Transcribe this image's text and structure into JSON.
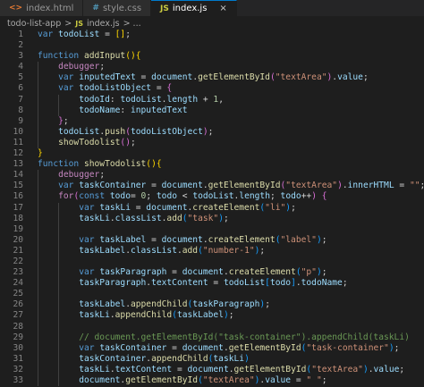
{
  "tabs": [
    {
      "icon": "html-file-icon",
      "icon_glyph": "<>",
      "icon_color": "#e37933",
      "label": "index.html",
      "active": false
    },
    {
      "icon": "css-file-icon",
      "icon_glyph": "#",
      "icon_color": "#519aba",
      "label": "style.css",
      "active": false
    },
    {
      "icon": "js-file-icon",
      "icon_glyph": "JS",
      "icon_color": "#cbcb41",
      "label": "index.js",
      "active": true
    }
  ],
  "close_glyph": "×",
  "breadcrumb": {
    "folder": "todo-list-app",
    "separator": ">",
    "badge": "JS",
    "file": "index.js",
    "tail": "> ..."
  },
  "lines": [
    {
      "n": "1",
      "tokens": [
        [
          "kw",
          "var "
        ],
        [
          "var",
          "todoList"
        ],
        [
          "plain",
          " = "
        ],
        [
          "br1",
          "[]"
        ],
        [
          "plain",
          ";"
        ]
      ]
    },
    {
      "n": "2",
      "tokens": []
    },
    {
      "n": "3",
      "tokens": [
        [
          "kw",
          "function "
        ],
        [
          "fn",
          "addInput"
        ],
        [
          "br1",
          "()"
        ],
        [
          "br1",
          "{"
        ]
      ]
    },
    {
      "n": "4",
      "indent": 1,
      "tokens": [
        [
          "ctl",
          "    debugger"
        ],
        [
          "plain",
          ";"
        ]
      ]
    },
    {
      "n": "5",
      "indent": 1,
      "tokens": [
        [
          "kw",
          "    var "
        ],
        [
          "var",
          "inputedText"
        ],
        [
          "plain",
          " = "
        ],
        [
          "var",
          "document"
        ],
        [
          "plain",
          "."
        ],
        [
          "fn",
          "getElementById"
        ],
        [
          "br2",
          "("
        ],
        [
          "str",
          "\"textArea\""
        ],
        [
          "br2",
          ")"
        ],
        [
          "plain",
          "."
        ],
        [
          "var",
          "value"
        ],
        [
          "plain",
          ";"
        ]
      ]
    },
    {
      "n": "6",
      "indent": 1,
      "tokens": [
        [
          "kw",
          "    var "
        ],
        [
          "var",
          "todoListObject"
        ],
        [
          "plain",
          " = "
        ],
        [
          "br2",
          "{"
        ]
      ]
    },
    {
      "n": "7",
      "indent": 2,
      "tokens": [
        [
          "var",
          "        todoId"
        ],
        [
          "plain",
          ": "
        ],
        [
          "var",
          "todoList"
        ],
        [
          "plain",
          "."
        ],
        [
          "var",
          "length"
        ],
        [
          "plain",
          " + "
        ],
        [
          "num",
          "1"
        ],
        [
          "plain",
          ","
        ]
      ]
    },
    {
      "n": "8",
      "indent": 2,
      "tokens": [
        [
          "var",
          "        todoName"
        ],
        [
          "plain",
          ": "
        ],
        [
          "var",
          "inputedText"
        ]
      ]
    },
    {
      "n": "9",
      "indent": 1,
      "tokens": [
        [
          "br2",
          "    }"
        ],
        [
          "plain",
          ";"
        ]
      ]
    },
    {
      "n": "10",
      "indent": 1,
      "tokens": [
        [
          "var",
          "    todoList"
        ],
        [
          "plain",
          "."
        ],
        [
          "fn",
          "push"
        ],
        [
          "br2",
          "("
        ],
        [
          "var",
          "todoListObject"
        ],
        [
          "br2",
          ")"
        ],
        [
          "plain",
          ";"
        ]
      ]
    },
    {
      "n": "11",
      "indent": 1,
      "tokens": [
        [
          "fn",
          "    showTodolist"
        ],
        [
          "br2",
          "()"
        ],
        [
          "plain",
          ";"
        ]
      ]
    },
    {
      "n": "12",
      "tokens": [
        [
          "br1",
          "}"
        ]
      ]
    },
    {
      "n": "13",
      "tokens": [
        [
          "kw",
          "function "
        ],
        [
          "fn",
          "showTodolist"
        ],
        [
          "br1",
          "()"
        ],
        [
          "br1",
          "{"
        ]
      ]
    },
    {
      "n": "14",
      "indent": 1,
      "tokens": [
        [
          "ctl",
          "    debugger"
        ],
        [
          "plain",
          ";"
        ]
      ]
    },
    {
      "n": "15",
      "indent": 1,
      "tokens": [
        [
          "kw",
          "    var "
        ],
        [
          "var",
          "taskContainer"
        ],
        [
          "plain",
          " = "
        ],
        [
          "var",
          "document"
        ],
        [
          "plain",
          "."
        ],
        [
          "fn",
          "getElementById"
        ],
        [
          "br2",
          "("
        ],
        [
          "str",
          "\"textArea\""
        ],
        [
          "br2",
          ")"
        ],
        [
          "plain",
          "."
        ],
        [
          "var",
          "innerHTML"
        ],
        [
          "plain",
          " = "
        ],
        [
          "str",
          "\"\""
        ],
        [
          "plain",
          ";"
        ]
      ]
    },
    {
      "n": "16",
      "indent": 1,
      "tokens": [
        [
          "ctl",
          "    for"
        ],
        [
          "br2",
          "("
        ],
        [
          "kw",
          "const "
        ],
        [
          "var",
          "todo"
        ],
        [
          "plain",
          "= "
        ],
        [
          "num",
          "0"
        ],
        [
          "plain",
          "; "
        ],
        [
          "var",
          "todo"
        ],
        [
          "plain",
          " < "
        ],
        [
          "var",
          "todoList"
        ],
        [
          "plain",
          "."
        ],
        [
          "var",
          "length"
        ],
        [
          "plain",
          "; "
        ],
        [
          "var",
          "todo"
        ],
        [
          "plain",
          "++"
        ],
        [
          "br2",
          ")"
        ],
        [
          "plain",
          " "
        ],
        [
          "br2",
          "{"
        ]
      ]
    },
    {
      "n": "17",
      "indent": 2,
      "tokens": [
        [
          "kw",
          "        var "
        ],
        [
          "var",
          "taskLi"
        ],
        [
          "plain",
          " = "
        ],
        [
          "var",
          "document"
        ],
        [
          "plain",
          "."
        ],
        [
          "fn",
          "createElement"
        ],
        [
          "br3",
          "("
        ],
        [
          "str",
          "\"li\""
        ],
        [
          "br3",
          ")"
        ],
        [
          "plain",
          ";"
        ]
      ]
    },
    {
      "n": "18",
      "indent": 2,
      "tokens": [
        [
          "var",
          "        taskLi"
        ],
        [
          "plain",
          "."
        ],
        [
          "var",
          "classList"
        ],
        [
          "plain",
          "."
        ],
        [
          "fn",
          "add"
        ],
        [
          "br3",
          "("
        ],
        [
          "str",
          "\"task\""
        ],
        [
          "br3",
          ")"
        ],
        [
          "plain",
          ";"
        ]
      ]
    },
    {
      "n": "19",
      "indent": 2,
      "tokens": []
    },
    {
      "n": "20",
      "indent": 2,
      "tokens": [
        [
          "kw",
          "        var "
        ],
        [
          "var",
          "taskLabel"
        ],
        [
          "plain",
          " = "
        ],
        [
          "var",
          "document"
        ],
        [
          "plain",
          "."
        ],
        [
          "fn",
          "createElement"
        ],
        [
          "br3",
          "("
        ],
        [
          "str",
          "\"label\""
        ],
        [
          "br3",
          ")"
        ],
        [
          "plain",
          ";"
        ]
      ]
    },
    {
      "n": "21",
      "indent": 2,
      "tokens": [
        [
          "var",
          "        taskLabel"
        ],
        [
          "plain",
          "."
        ],
        [
          "var",
          "classList"
        ],
        [
          "plain",
          "."
        ],
        [
          "fn",
          "add"
        ],
        [
          "br3",
          "("
        ],
        [
          "str",
          "\"number-1\""
        ],
        [
          "br3",
          ")"
        ],
        [
          "plain",
          ";"
        ]
      ]
    },
    {
      "n": "22",
      "indent": 2,
      "tokens": []
    },
    {
      "n": "23",
      "indent": 2,
      "tokens": [
        [
          "kw",
          "        var "
        ],
        [
          "var",
          "taskParagraph"
        ],
        [
          "plain",
          " = "
        ],
        [
          "var",
          "document"
        ],
        [
          "plain",
          "."
        ],
        [
          "fn",
          "createElement"
        ],
        [
          "br3",
          "("
        ],
        [
          "str",
          "\"p\""
        ],
        [
          "br3",
          ")"
        ],
        [
          "plain",
          ";"
        ]
      ]
    },
    {
      "n": "24",
      "indent": 2,
      "tokens": [
        [
          "var",
          "        taskParagraph"
        ],
        [
          "plain",
          "."
        ],
        [
          "var",
          "textContent"
        ],
        [
          "plain",
          " = "
        ],
        [
          "var",
          "todoList"
        ],
        [
          "br3",
          "["
        ],
        [
          "var",
          "todo"
        ],
        [
          "br3",
          "]"
        ],
        [
          "plain",
          "."
        ],
        [
          "var",
          "todoName"
        ],
        [
          "plain",
          ";"
        ]
      ]
    },
    {
      "n": "25",
      "indent": 2,
      "tokens": []
    },
    {
      "n": "26",
      "indent": 2,
      "tokens": [
        [
          "var",
          "        taskLabel"
        ],
        [
          "plain",
          "."
        ],
        [
          "fn",
          "appendChild"
        ],
        [
          "br3",
          "("
        ],
        [
          "var",
          "taskParagraph"
        ],
        [
          "br3",
          ")"
        ],
        [
          "plain",
          ";"
        ]
      ]
    },
    {
      "n": "27",
      "indent": 2,
      "tokens": [
        [
          "var",
          "        taskLi"
        ],
        [
          "plain",
          "."
        ],
        [
          "fn",
          "appendChild"
        ],
        [
          "br3",
          "("
        ],
        [
          "var",
          "taskLabel"
        ],
        [
          "br3",
          ")"
        ],
        [
          "plain",
          ";"
        ]
      ]
    },
    {
      "n": "28",
      "indent": 2,
      "tokens": []
    },
    {
      "n": "29",
      "indent": 2,
      "tokens": [
        [
          "com",
          "        // document.getElementById(\"task-container\").appendChild(taskLi)"
        ]
      ]
    },
    {
      "n": "30",
      "indent": 2,
      "tokens": [
        [
          "kw",
          "        var "
        ],
        [
          "var",
          "taskContainer"
        ],
        [
          "plain",
          " = "
        ],
        [
          "var",
          "document"
        ],
        [
          "plain",
          "."
        ],
        [
          "fn",
          "getElementById"
        ],
        [
          "br3",
          "("
        ],
        [
          "str",
          "\"task-container\""
        ],
        [
          "br3",
          ")"
        ],
        [
          "plain",
          ";"
        ]
      ]
    },
    {
      "n": "31",
      "indent": 2,
      "tokens": [
        [
          "var",
          "        taskContainer"
        ],
        [
          "plain",
          "."
        ],
        [
          "fn",
          "appendChild"
        ],
        [
          "br3",
          "("
        ],
        [
          "var",
          "taskLi"
        ],
        [
          "br3",
          ")"
        ]
      ]
    },
    {
      "n": "32",
      "indent": 2,
      "tokens": [
        [
          "var",
          "        taskLi"
        ],
        [
          "plain",
          "."
        ],
        [
          "var",
          "textContent"
        ],
        [
          "plain",
          " = "
        ],
        [
          "var",
          "document"
        ],
        [
          "plain",
          "."
        ],
        [
          "fn",
          "getElementById"
        ],
        [
          "br3",
          "("
        ],
        [
          "str",
          "\"textArea\""
        ],
        [
          "br3",
          ")"
        ],
        [
          "plain",
          "."
        ],
        [
          "var",
          "value"
        ],
        [
          "plain",
          ";"
        ]
      ]
    },
    {
      "n": "33",
      "indent": 2,
      "tokens": [
        [
          "var",
          "        document"
        ],
        [
          "plain",
          "."
        ],
        [
          "fn",
          "getElementById"
        ],
        [
          "br3",
          "("
        ],
        [
          "str",
          "\"textArea\""
        ],
        [
          "br3",
          ")"
        ],
        [
          "plain",
          "."
        ],
        [
          "var",
          "value"
        ],
        [
          "plain",
          " = "
        ],
        [
          "str",
          "\" \""
        ],
        [
          "plain",
          ";"
        ]
      ]
    }
  ]
}
